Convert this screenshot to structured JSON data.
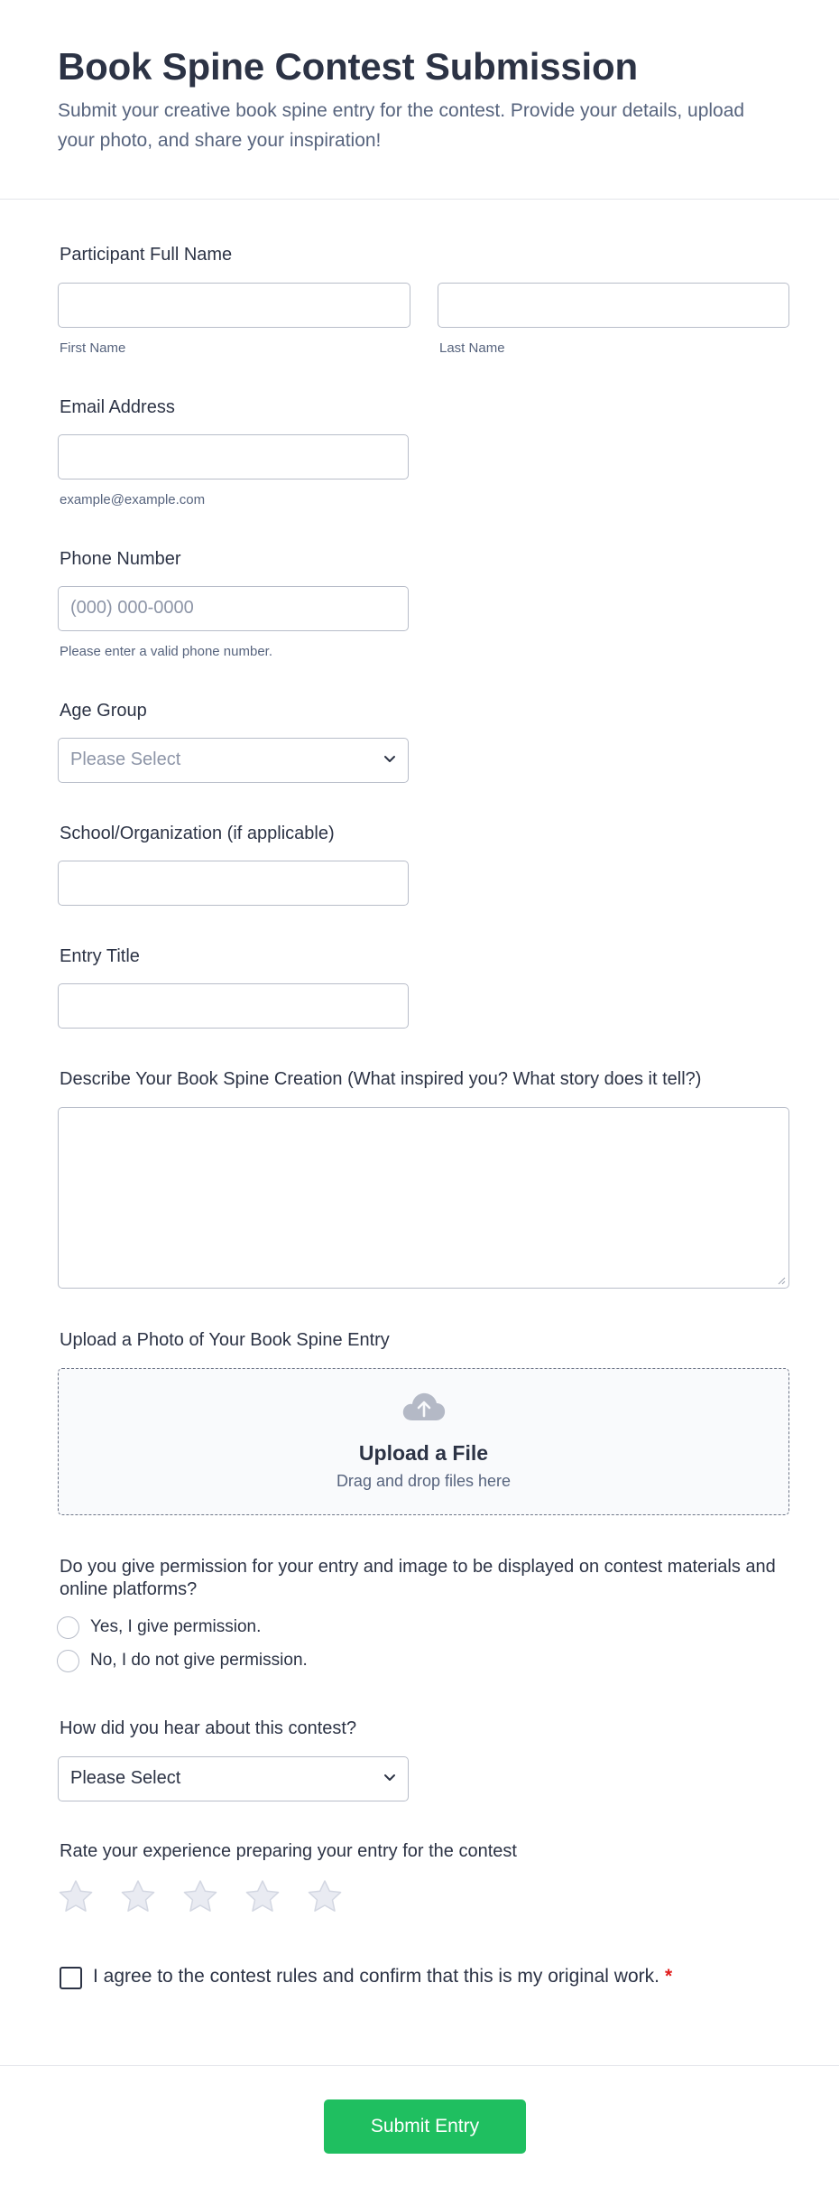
{
  "header": {
    "title": "Book Spine Contest Submission",
    "subtitle": "Submit your creative book spine entry for the contest. Provide your details, upload your photo, and share your inspiration!"
  },
  "full_name": {
    "label": "Participant Full Name",
    "first_sublabel": "First Name",
    "last_sublabel": "Last Name",
    "first_value": "",
    "last_value": ""
  },
  "email": {
    "label": "Email Address",
    "sublabel": "example@example.com",
    "value": ""
  },
  "phone": {
    "label": "Phone Number",
    "placeholder": "(000) 000-0000",
    "sublabel": "Please enter a valid phone number."
  },
  "age_group": {
    "label": "Age Group",
    "selected": "Please Select"
  },
  "school": {
    "label": "School/Organization (if applicable)",
    "value": ""
  },
  "entry_title": {
    "label": "Entry Title",
    "value": ""
  },
  "description": {
    "label": "Describe Your Book Spine Creation (What inspired you? What story does it tell?)",
    "value": ""
  },
  "upload": {
    "label": "Upload a Photo of Your Book Spine Entry",
    "title": "Upload a File",
    "subtitle": "Drag and drop files here",
    "icon": "cloud-upload-icon"
  },
  "permission": {
    "label": "Do you give permission for your entry and image to be displayed on contest materials and online platforms?",
    "options": [
      "Yes, I give permission.",
      "No, I do not give permission."
    ]
  },
  "heard_about": {
    "label": "How did you hear about this contest?",
    "selected": "Please Select"
  },
  "rating": {
    "label": "Rate your experience preparing your entry for the contest",
    "max": 5,
    "value": 0,
    "icon": "star-icon"
  },
  "agreement": {
    "label": "I agree to the contest rules and confirm that this is my original work.",
    "required_mark": "*"
  },
  "submit": {
    "label": "Submit Entry"
  },
  "colors": {
    "submit_bg": "#1fbf60",
    "text_dark": "#2c3345",
    "text_muted": "#57647e",
    "required": "#e11d1d",
    "star_fill": "#e9ebf2",
    "star_stroke": "#d3d7e2"
  }
}
